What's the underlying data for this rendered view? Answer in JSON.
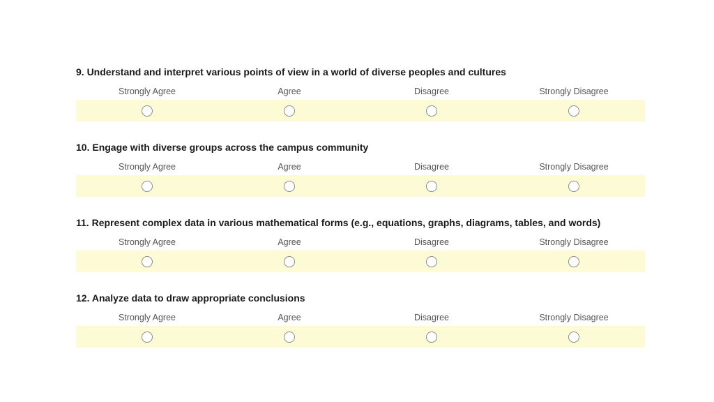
{
  "scale": [
    "Strongly Agree",
    "Agree",
    "Disagree",
    "Strongly Disagree"
  ],
  "questions": [
    {
      "title": "9. Understand and interpret various points of view in a world of diverse peoples and cultures"
    },
    {
      "title": "10. Engage with diverse groups across the campus community"
    },
    {
      "title": "11. Represent complex data in various mathematical forms (e.g., equations, graphs, diagrams, tables, and words)"
    },
    {
      "title": "12. Analyze data to draw appropriate conclusions"
    }
  ]
}
